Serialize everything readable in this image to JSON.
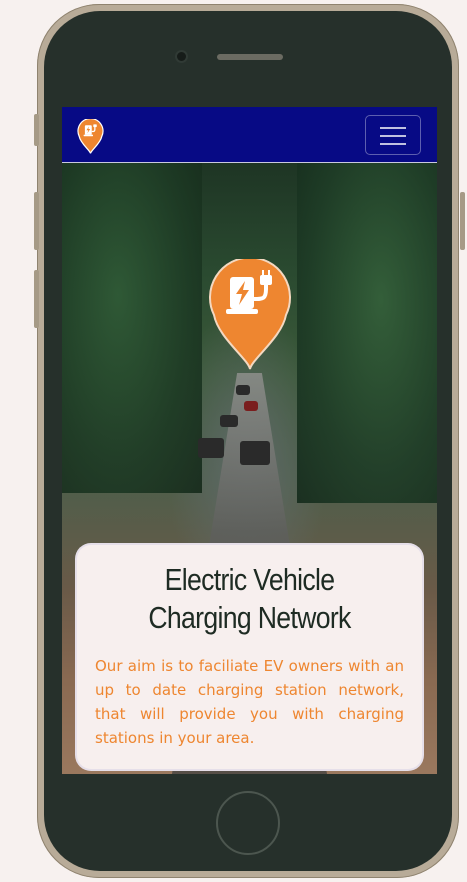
{
  "navbar": {
    "logo_icon": "ev-charging-pin-icon",
    "menu_icon": "hamburger-menu-icon",
    "background": "#070a85"
  },
  "hero": {
    "pin_icon": "ev-charging-pin-icon",
    "pin_color": "#ee8630"
  },
  "card": {
    "title": "Electric Vehicle Charging Network",
    "text": "Our aim is to faciliate EV owners with an up to date charging station network, that will provide you with charging stations in your area.",
    "text_color": "#ee8630"
  }
}
